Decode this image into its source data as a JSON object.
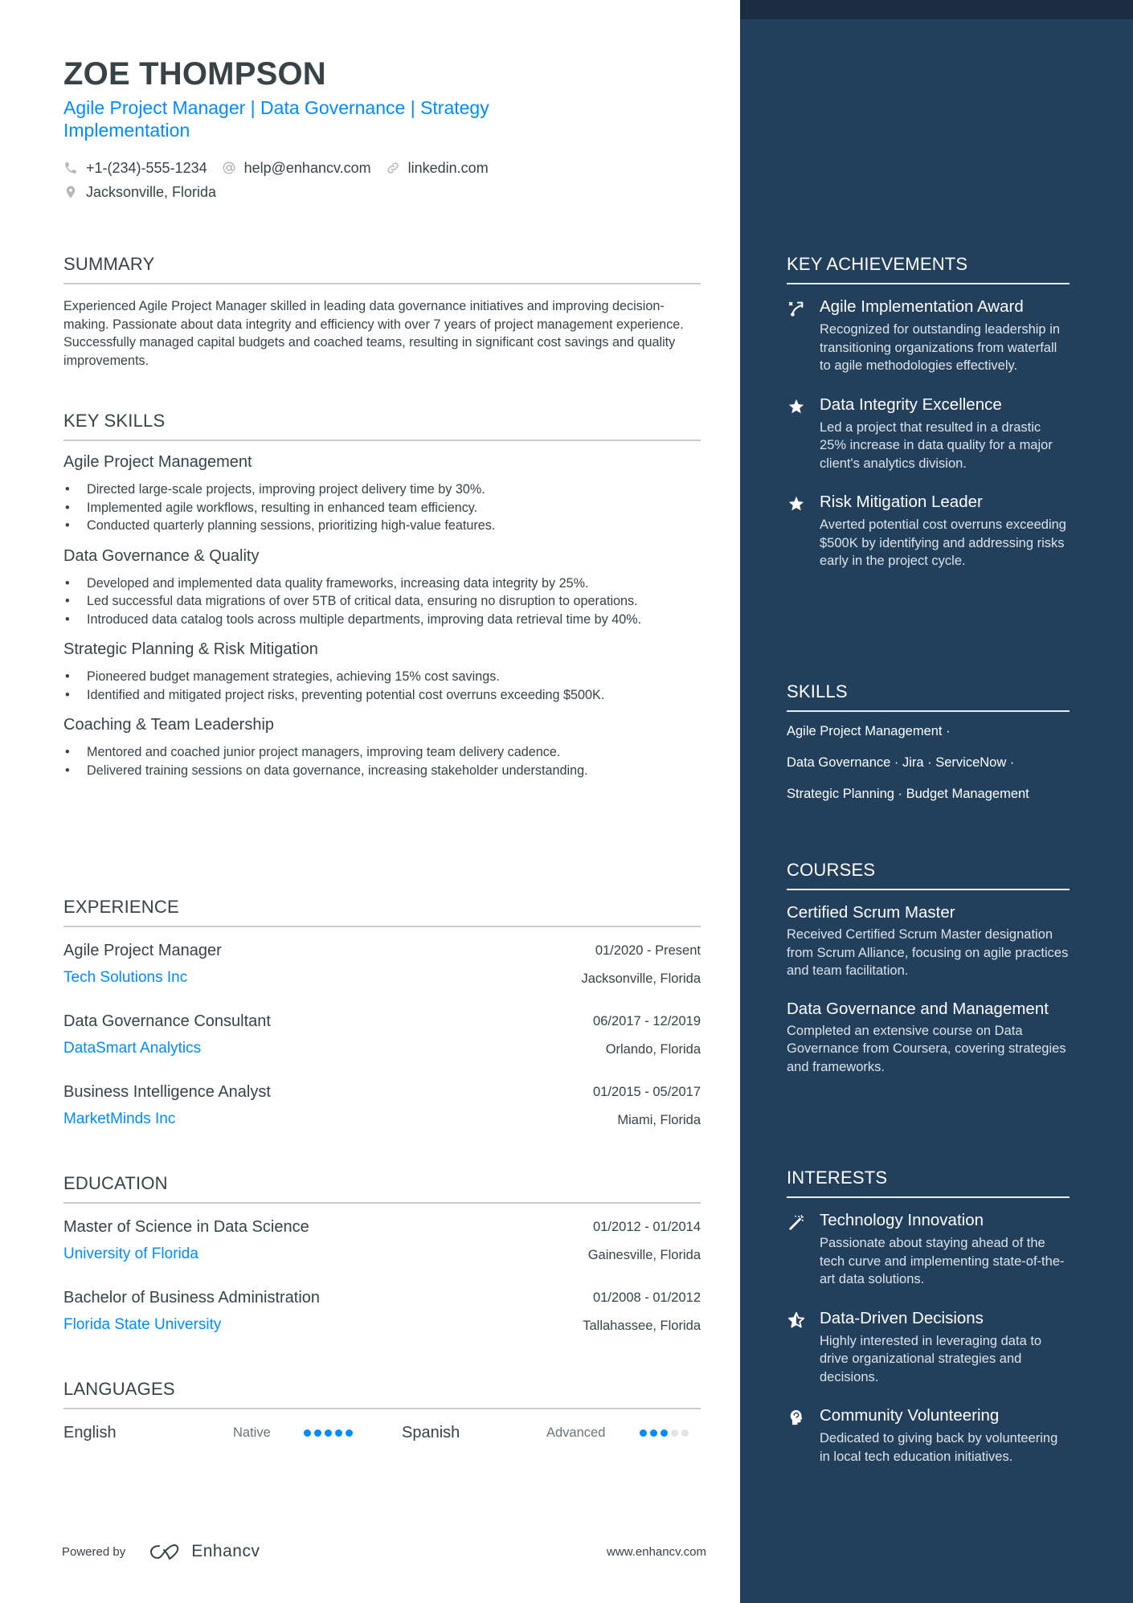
{
  "header": {
    "name": "ZOE THOMPSON",
    "headline": "Agile Project Manager | Data Governance | Strategy Implementation",
    "contacts": {
      "phone": "+1-(234)-555-1234",
      "email": "help@enhancv.com",
      "link": "linkedin.com",
      "location": "Jacksonville, Florida"
    }
  },
  "summary": {
    "title": "SUMMARY",
    "text": "Experienced Agile Project Manager skilled in leading data governance initiatives and improving decision-making. Passionate about data integrity and efficiency with over 7 years of project management experience. Successfully managed capital budgets and coached teams, resulting in significant cost savings and quality improvements."
  },
  "key_skills": {
    "title": "KEY SKILLS",
    "groups": [
      {
        "title": "Agile Project Management",
        "bullets": [
          "Directed large-scale projects, improving project delivery time by 30%.",
          "Implemented agile workflows, resulting in enhanced team efficiency.",
          "Conducted quarterly planning sessions, prioritizing high-value features."
        ]
      },
      {
        "title": "Data Governance & Quality",
        "bullets": [
          "Developed and implemented data quality frameworks, increasing data integrity by 25%.",
          "Led successful data migrations of over 5TB of critical data, ensuring no disruption to operations.",
          "Introduced data catalog tools across multiple departments, improving data retrieval time by 40%."
        ]
      },
      {
        "title": "Strategic Planning & Risk Mitigation",
        "bullets": [
          "Pioneered budget management strategies, achieving 15% cost savings.",
          "Identified and mitigated project risks, preventing potential cost overruns exceeding $500K."
        ]
      },
      {
        "title": "Coaching & Team Leadership",
        "bullets": [
          "Mentored and coached junior project managers, improving team delivery cadence.",
          "Delivered training sessions on data governance, increasing stakeholder understanding."
        ]
      }
    ]
  },
  "experience": {
    "title": "EXPERIENCE",
    "items": [
      {
        "title": "Agile Project Manager",
        "org": "Tech Solutions Inc",
        "dates": "01/2020 - Present",
        "location": "Jacksonville, Florida"
      },
      {
        "title": "Data Governance Consultant",
        "org": "DataSmart Analytics",
        "dates": "06/2017 - 12/2019",
        "location": "Orlando, Florida"
      },
      {
        "title": "Business Intelligence Analyst",
        "org": "MarketMinds Inc",
        "dates": "01/2015 - 05/2017",
        "location": "Miami, Florida"
      }
    ]
  },
  "education": {
    "title": "EDUCATION",
    "items": [
      {
        "title": "Master of Science in Data Science",
        "org": "University of Florida",
        "dates": "01/2012 - 01/2014",
        "location": "Gainesville, Florida"
      },
      {
        "title": "Bachelor of Business Administration",
        "org": "Florida State University",
        "dates": "01/2008 - 01/2012",
        "location": "Tallahassee, Florida"
      }
    ]
  },
  "languages": {
    "title": "LANGUAGES",
    "items": [
      {
        "name": "English",
        "level": "Native",
        "rating": 5,
        "max": 5
      },
      {
        "name": "Spanish",
        "level": "Advanced",
        "rating": 3,
        "max": 5
      }
    ]
  },
  "footer": {
    "powered_by": "Powered by",
    "brand": "Enhancv",
    "website": "www.enhancv.com"
  },
  "sidebar": {
    "achievements": {
      "title": "KEY ACHIEVEMENTS",
      "items": [
        {
          "icon": "agile-route-icon",
          "title": "Agile Implementation Award",
          "desc": "Recognized for outstanding leadership in transitioning organizations from waterfall to agile methodologies effectively."
        },
        {
          "icon": "star-icon",
          "title": "Data Integrity Excellence",
          "desc": "Led a project that resulted in a drastic 25% increase in data quality for a major client's analytics division."
        },
        {
          "icon": "star-icon",
          "title": "Risk Mitigation Leader",
          "desc": "Averted potential cost overruns exceeding $500K by identifying and addressing risks early in the project cycle."
        }
      ]
    },
    "skills": {
      "title": "SKILLS",
      "lines": [
        "Agile Project Management ·",
        "Data Governance · Jira · ServiceNow ·",
        "Strategic Planning · Budget Management"
      ]
    },
    "courses": {
      "title": "COURSES",
      "items": [
        {
          "title": "Certified Scrum Master",
          "desc": "Received Certified Scrum Master designation from Scrum Alliance, focusing on agile practices and team facilitation."
        },
        {
          "title": "Data Governance and Management",
          "desc": "Completed an extensive course on Data Governance from Coursera, covering strategies and frameworks."
        }
      ]
    },
    "interests": {
      "title": "INTERESTS",
      "items": [
        {
          "icon": "magic-wand-icon",
          "title": "Technology Innovation",
          "desc": "Passionate about staying ahead of the tech curve and implementing state-of-the-art data solutions."
        },
        {
          "icon": "half-star-icon",
          "title": "Data-Driven Decisions",
          "desc": "Highly interested in leveraging data to drive organizational strategies and decisions."
        },
        {
          "icon": "head-icon",
          "title": "Community Volunteering",
          "desc": "Dedicated to giving back by volunteering in local tech education initiatives."
        }
      ]
    }
  },
  "colors": {
    "accent": "#008CFF",
    "sidebar_bg": "#223F5C",
    "sidebar_top": "#1A2D43",
    "text": "#384347"
  }
}
